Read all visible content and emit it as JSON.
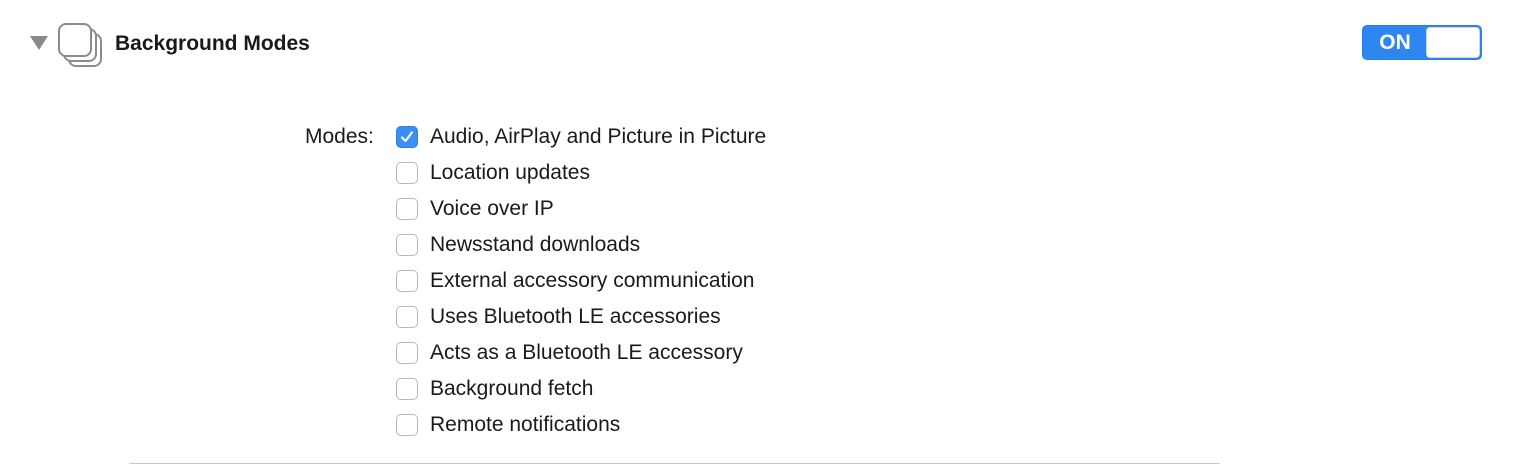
{
  "section": {
    "title": "Background Modes",
    "icon": "background-modes-icon",
    "expanded": true,
    "toggle_label": "ON",
    "toggle_on": true
  },
  "modes": {
    "label": "Modes:",
    "items": [
      {
        "label": "Audio, AirPlay and Picture in Picture",
        "checked": true
      },
      {
        "label": "Location updates",
        "checked": false
      },
      {
        "label": "Voice over IP",
        "checked": false
      },
      {
        "label": "Newsstand downloads",
        "checked": false
      },
      {
        "label": "External accessory communication",
        "checked": false
      },
      {
        "label": "Uses Bluetooth LE accessories",
        "checked": false
      },
      {
        "label": "Acts as a Bluetooth LE accessory",
        "checked": false
      },
      {
        "label": "Background fetch",
        "checked": false
      },
      {
        "label": "Remote notifications",
        "checked": false
      }
    ]
  },
  "colors": {
    "accent": "#2e87f0",
    "checkbox_checked": "#3a8ef5",
    "text": "#1a1a1a"
  }
}
